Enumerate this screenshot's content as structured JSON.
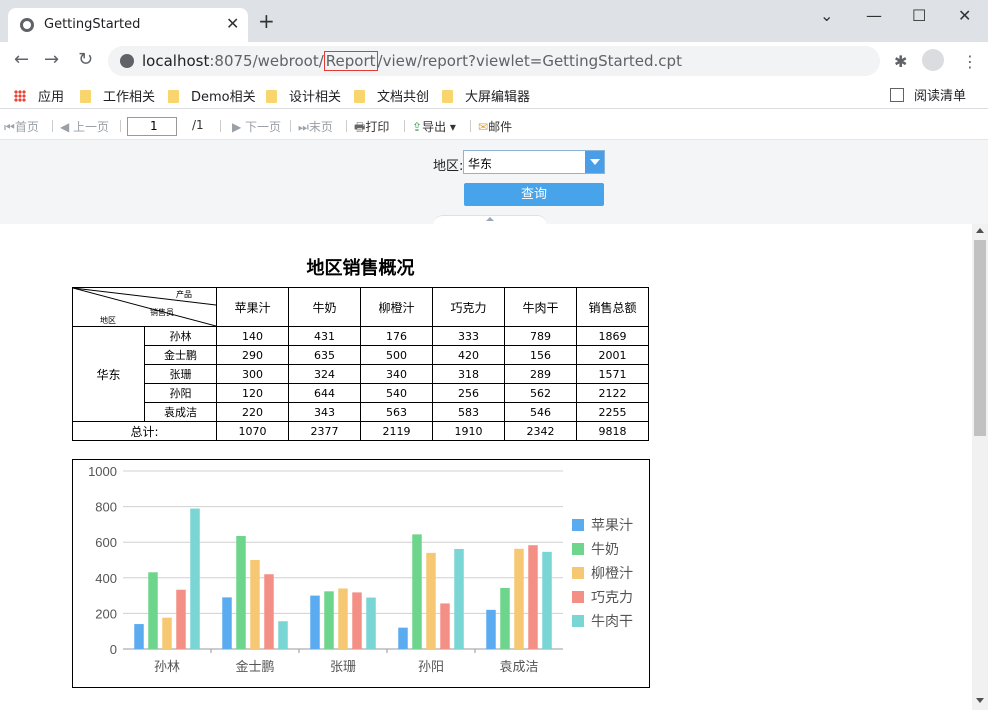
{
  "browser": {
    "tab_title": "GettingStarted",
    "tab_close": "✕",
    "new_tab": "+",
    "url_host": "localhost",
    "url_before": ":8075/webroot/",
    "url_highlight": "Report",
    "url_after": "/view/report?viewlet=GettingStarted.cpt",
    "highlight_color": "#e53935"
  },
  "bookmarks": {
    "items": [
      "应用",
      "工作相关",
      "Demo相关",
      "设计相关",
      "文档共创",
      "大屏编辑器"
    ],
    "reading_list": "阅读清单"
  },
  "toolbar": {
    "first": "首页",
    "prev": "上一页",
    "page_value": "1",
    "page_total": "/1",
    "next": "下一页",
    "last": "末页",
    "print": "打印",
    "export": "导出",
    "mail": "邮件"
  },
  "params": {
    "region_label": "地区:",
    "region_value": "华东",
    "query_label": "查询"
  },
  "report": {
    "title": "地区销售概况",
    "corner_product": "产品",
    "corner_sales": "销售员",
    "corner_region": "地区",
    "columns": [
      "苹果汁",
      "牛奶",
      "柳橙汁",
      "巧克力",
      "牛肉干",
      "销售总额"
    ],
    "region": "华东",
    "rows": [
      {
        "name": "孙林",
        "values": [
          "140",
          "431",
          "176",
          "333",
          "789",
          "1869"
        ]
      },
      {
        "name": "金士鹏",
        "values": [
          "290",
          "635",
          "500",
          "420",
          "156",
          "2001"
        ]
      },
      {
        "name": "张珊",
        "values": [
          "300",
          "324",
          "340",
          "318",
          "289",
          "1571"
        ]
      },
      {
        "name": "孙阳",
        "values": [
          "120",
          "644",
          "540",
          "256",
          "562",
          "2122"
        ]
      },
      {
        "name": "袁成洁",
        "values": [
          "220",
          "343",
          "563",
          "583",
          "546",
          "2255"
        ]
      }
    ],
    "total_label": "总计:",
    "totals": [
      "1070",
      "2377",
      "2119",
      "1910",
      "2342",
      "9818"
    ]
  },
  "chart_data": {
    "type": "bar",
    "categories": [
      "孙林",
      "金士鹏",
      "张珊",
      "孙阳",
      "袁成洁"
    ],
    "series": [
      {
        "name": "苹果汁",
        "color": "#5aabf0",
        "values": [
          140,
          290,
          300,
          120,
          220
        ]
      },
      {
        "name": "牛奶",
        "color": "#6dd58c",
        "values": [
          431,
          635,
          324,
          644,
          343
        ]
      },
      {
        "name": "柳橙汁",
        "color": "#f7c873",
        "values": [
          176,
          500,
          340,
          540,
          563
        ]
      },
      {
        "name": "巧克力",
        "color": "#f48f85",
        "values": [
          333,
          420,
          318,
          256,
          583
        ]
      },
      {
        "name": "牛肉干",
        "color": "#7ad6d4",
        "values": [
          789,
          156,
          289,
          562,
          546
        ]
      }
    ],
    "ylim": [
      0,
      1000
    ],
    "yticks": [
      "0",
      "200",
      "400",
      "600",
      "800",
      "1000"
    ],
    "grid": true,
    "legend": "right"
  }
}
